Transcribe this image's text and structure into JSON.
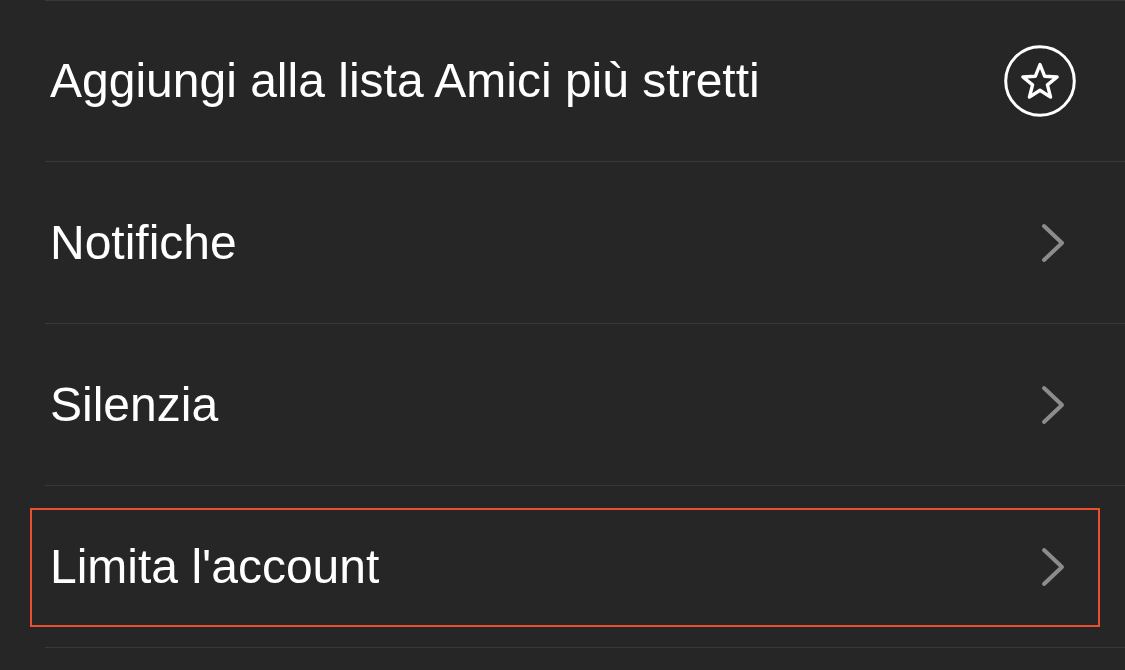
{
  "items": [
    {
      "label": "Aggiungi alla lista Amici più stretti",
      "kind": "star",
      "highlighted": false
    },
    {
      "label": "Notifiche",
      "kind": "link",
      "highlighted": false
    },
    {
      "label": "Silenzia",
      "kind": "link",
      "highlighted": false
    },
    {
      "label": "Limita l'account",
      "kind": "link",
      "highlighted": true
    }
  ]
}
